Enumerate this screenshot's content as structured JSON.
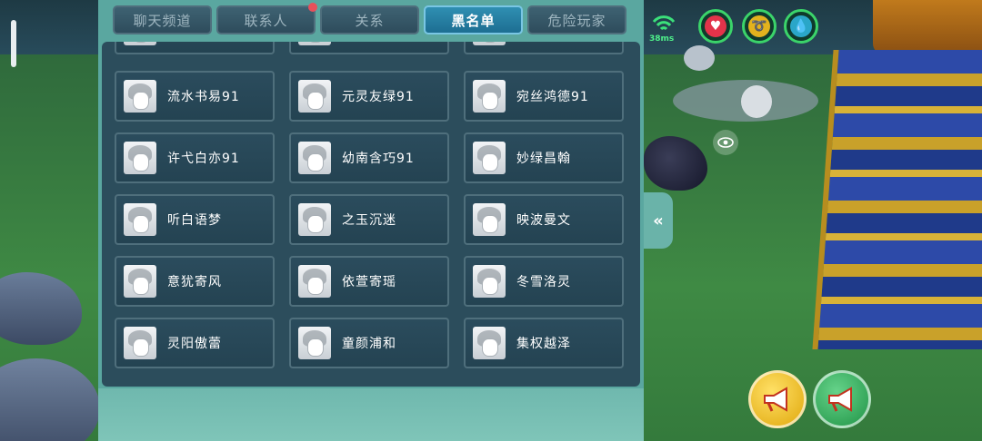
{
  "tabs": [
    {
      "label": "聊天频道",
      "active": false,
      "has_badge": false
    },
    {
      "label": "联系人",
      "active": false,
      "has_badge": true
    },
    {
      "label": "关系",
      "active": false,
      "has_badge": false
    },
    {
      "label": "黑名单",
      "active": true,
      "has_badge": false
    },
    {
      "label": "危险玩家",
      "active": false,
      "has_badge": false
    }
  ],
  "blacklist": [
    [
      "流水书易91",
      "元灵友绿91",
      "宛丝鸿德91"
    ],
    [
      "许弋白亦91",
      "幼南含巧91",
      "妙绿昌翰"
    ],
    [
      "听白语梦",
      "之玉沉迷",
      "映波曼文"
    ],
    [
      "意犹寄风",
      "依萱寄瑶",
      "冬雪洛灵"
    ],
    [
      "灵阳傲蕾",
      "童颜浦和",
      "集权越泽"
    ]
  ],
  "hud": {
    "ping": "38ms",
    "status_icons": [
      "heart-icon",
      "food-icon",
      "water-drop-icon"
    ],
    "colors": {
      "ring": "#3bd46a",
      "heart": "#e2334a",
      "food": "#e3b21e",
      "water": "#2aa6c8"
    }
  },
  "controls": {
    "collapse_glyph": "«",
    "eye_glyph": "👁",
    "horn_yellow_color": "#f2c21a",
    "horn_green_color": "#34b45a"
  }
}
